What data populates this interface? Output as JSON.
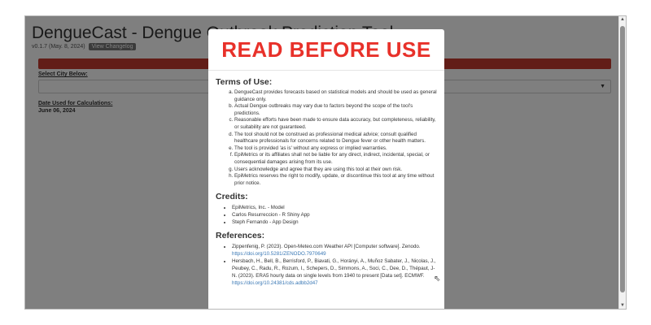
{
  "app": {
    "title": "DengueCast - Dengue Outbreak Prediction Tool",
    "version": "v0.1.7 (May. 8, 2024)",
    "changelog_button": "View Changelog",
    "select_city_label": "Select City Below:",
    "date_label": "Date Used for Calculations:",
    "date_value": "June 06, 2024"
  },
  "modal": {
    "title": "READ BEFORE USE",
    "terms_heading": "Terms of Use:",
    "terms": [
      "DengueCast provides forecasts based on statistical models and should be used as general guidance only.",
      "Actual Dengue outbreaks may vary due to factors beyond the scope of the tool's predictions.",
      "Reasonable efforts have been made to ensure data accuracy, but completeness, reliability, or suitability are not guaranteed.",
      "The tool should not be construed as professional medical advice; consult qualified healthcare professionals for concerns related to Dengue fever or other health matters.",
      "The tool is provided 'as is' without any express or implied warranties.",
      "EpiMetrics or its affiliates shall not be liable for any direct, indirect, incidental, special, or consequential damages arising from its use.",
      "Users acknowledge and agree that they are using this tool at their own risk.",
      "EpiMetrics reserves the right to modify, update, or discontinue this tool at any time without prior notice."
    ],
    "credits_heading": "Credits:",
    "credits": [
      "EpiMetrics, Inc. - Model",
      "Carlos Resurreccion - R Shiny App",
      "Steph Fernando - App Design"
    ],
    "references_heading": "References:",
    "references": [
      {
        "text": "Zippenfenig, P. (2023). Open-Meteo.com Weather API [Computer software]. Zenodo.",
        "link": "https://doi.org/10.5281/ZENODO.7970649"
      },
      {
        "text": "Hersbach, H., Bell, B., Berrisford, P., Biavati, G., Horányi, A., Muñoz Sabater, J., Nicolas, J., Peubey, C., Radu, R., Rozum, I., Schepers, D., Simmons, A., Soci, C., Dee, D., Thépaut, J-N. (2023). ERA5 hourly data on single levels from 1940 to present [Data set]. ECMWF.",
        "link": "https://doi.org/10.24381/cds.adbb2d47"
      }
    ]
  },
  "colors": {
    "accent_red": "#e8312a",
    "bar_red": "#c43a2e",
    "link_blue": "#3a78b5"
  }
}
